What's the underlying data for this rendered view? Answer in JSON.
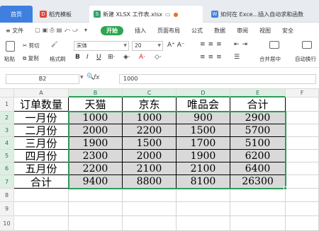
{
  "tabs": {
    "home": "首页",
    "t1": "稻壳模板",
    "t2": "新建 XLSX 工作表.xlsx",
    "t3": "如何在 Exce...插入自动求和函数"
  },
  "menu": {
    "file": "文件",
    "start": "开始",
    "insert": "插入",
    "layout": "页面布局",
    "formula": "公式",
    "data": "数据",
    "review": "审阅",
    "view": "视图",
    "security": "安全"
  },
  "ribbon": {
    "paste": "粘贴",
    "cut": "剪切",
    "copy": "复制",
    "format_painter": "格式刷",
    "font_name": "宋体",
    "font_size": "20",
    "merge": "合并居中",
    "autowrap": "自动换行"
  },
  "formula_bar": {
    "cell_ref": "B2",
    "fx": "fx",
    "value": "1000"
  },
  "columns": [
    "A",
    "B",
    "C",
    "D",
    "E",
    "F"
  ],
  "rows": [
    "1",
    "2",
    "3",
    "4",
    "5",
    "6",
    "7",
    "8",
    "9",
    "10"
  ],
  "sheet": {
    "headers": [
      "订单数量",
      "天猫",
      "京东",
      "唯品会",
      "合计"
    ],
    "data": [
      [
        "一月份",
        "1000",
        "1000",
        "900",
        "2900"
      ],
      [
        "二月份",
        "2000",
        "2200",
        "1500",
        "5700"
      ],
      [
        "三月份",
        "1900",
        "1500",
        "1700",
        "5100"
      ],
      [
        "四月份",
        "2300",
        "2000",
        "1900",
        "6200"
      ],
      [
        "五月份",
        "2200",
        "2100",
        "2100",
        "6400"
      ],
      [
        "合计",
        "9400",
        "8800",
        "8100",
        "26300"
      ]
    ]
  },
  "colors": {
    "accent": "#2e9b57",
    "home_tab": "#3f7fe0",
    "selection_fill": "#d9d9d9"
  }
}
